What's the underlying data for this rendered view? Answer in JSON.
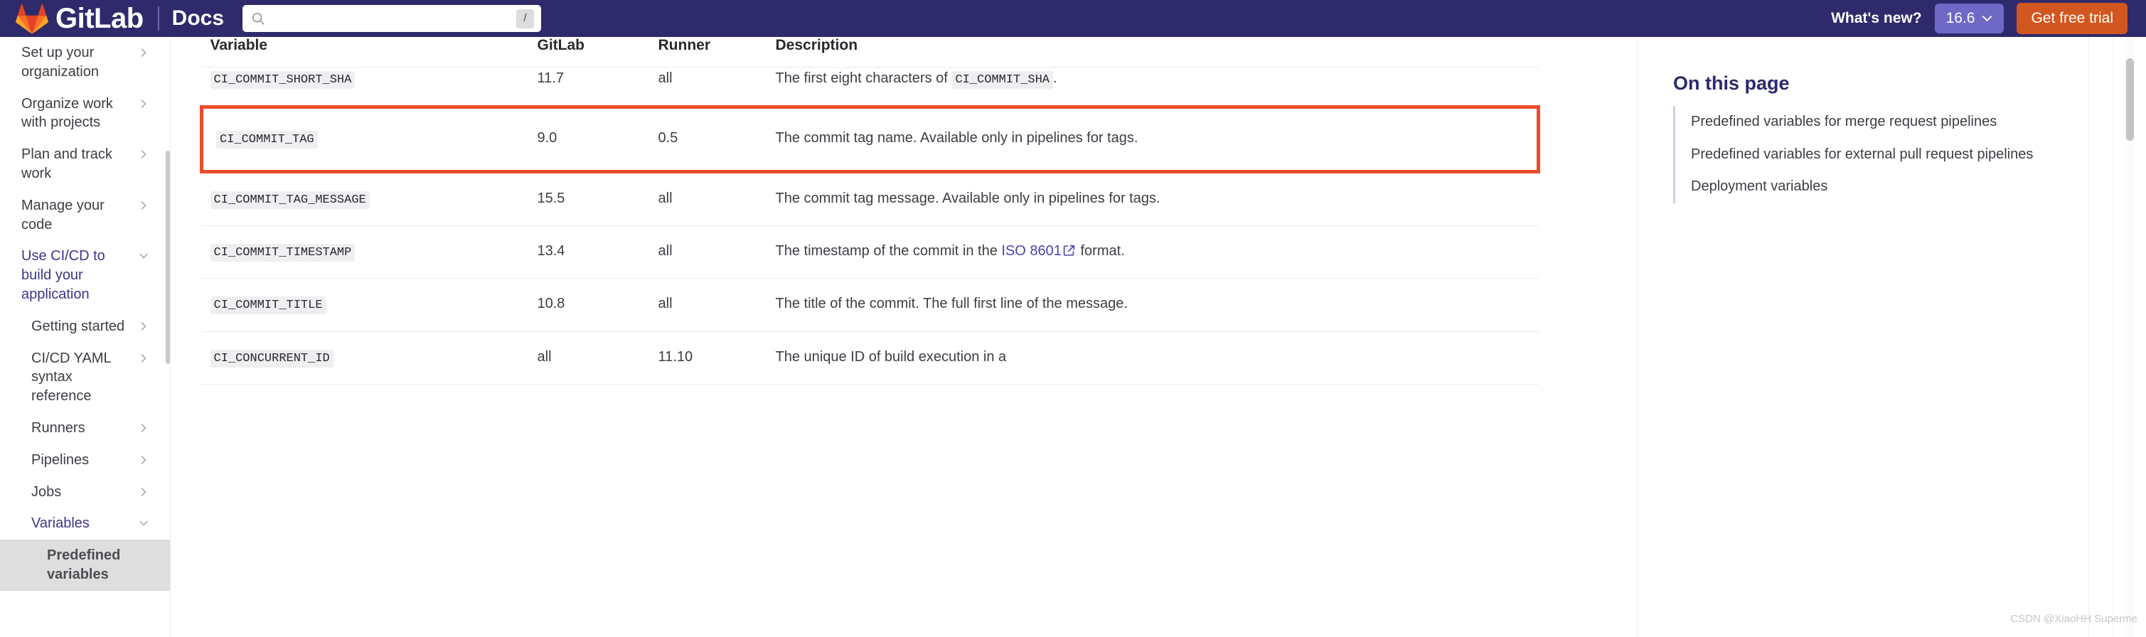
{
  "header": {
    "brand_name": "GitLab",
    "brand_suffix": "Docs",
    "search": {
      "value": "",
      "placeholder": "",
      "shortcut_key": "/",
      "icon": "search-icon"
    },
    "whats_new_label": "What's new?",
    "version_label": "16.6",
    "version_icon": "chevron-down-icon",
    "trial_label": "Get free trial",
    "colors": {
      "bar_bg": "#2f2a6b",
      "version_bg": "#6e69c4",
      "trial_bg": "#d2561f"
    }
  },
  "sidebar": {
    "items": [
      {
        "label": "Set up your organization",
        "icon": "chevron-right-icon",
        "level": 0,
        "state": "collapsed"
      },
      {
        "label": "Organize work with projects",
        "icon": "chevron-right-icon",
        "level": 0,
        "state": "collapsed"
      },
      {
        "label": "Plan and track work",
        "icon": "chevron-right-icon",
        "level": 0,
        "state": "collapsed"
      },
      {
        "label": "Manage your code",
        "icon": "chevron-right-icon",
        "level": 0,
        "state": "collapsed"
      },
      {
        "label": "Use CI/CD to build your application",
        "icon": "chevron-down-icon",
        "level": 0,
        "state": "expanded"
      },
      {
        "label": "Getting started",
        "icon": "chevron-right-icon",
        "level": 1,
        "state": "collapsed"
      },
      {
        "label": "CI/CD YAML syntax reference",
        "icon": "chevron-right-icon",
        "level": 1,
        "state": "collapsed"
      },
      {
        "label": "Runners",
        "icon": "chevron-right-icon",
        "level": 1,
        "state": "collapsed"
      },
      {
        "label": "Pipelines",
        "icon": "chevron-right-icon",
        "level": 1,
        "state": "collapsed"
      },
      {
        "label": "Jobs",
        "icon": "chevron-right-icon",
        "level": 1,
        "state": "collapsed"
      },
      {
        "label": "Variables",
        "icon": "chevron-down-icon",
        "level": 1,
        "state": "expanded"
      },
      {
        "label": "Predefined variables",
        "icon": "",
        "level": 2,
        "state": "current"
      }
    ]
  },
  "table": {
    "headers": [
      "Variable",
      "GitLab",
      "Runner",
      "Description"
    ],
    "rows": [
      {
        "variable": "CI_COMMIT_SHORT_SHA",
        "gitlab": "11.7",
        "runner": "all",
        "desc_prefix": "The first eight characters of ",
        "desc_code": "CI_COMMIT_SHA",
        "desc_suffix": ".",
        "clipped": true,
        "highlight": false
      },
      {
        "variable": "CI_COMMIT_TAG",
        "gitlab": "9.0",
        "runner": "0.5",
        "desc_prefix": "The commit tag name. Available only in pipelines for tags.",
        "desc_code": "",
        "desc_suffix": "",
        "clipped": false,
        "highlight": true
      },
      {
        "variable": "CI_COMMIT_TAG_MESSAGE",
        "gitlab": "15.5",
        "runner": "all",
        "desc_prefix": "The commit tag message. Available only in pipelines for tags.",
        "desc_code": "",
        "desc_suffix": "",
        "clipped": false,
        "highlight": false
      },
      {
        "variable": "CI_COMMIT_TIMESTAMP",
        "gitlab": "13.4",
        "runner": "all",
        "desc_prefix": "The timestamp of the commit in the ",
        "desc_link": "ISO 8601",
        "desc_link_icon": "external-link-icon",
        "desc_suffix": " format.",
        "clipped": false,
        "highlight": false
      },
      {
        "variable": "CI_COMMIT_TITLE",
        "gitlab": "10.8",
        "runner": "all",
        "desc_prefix": "The title of the commit. The full first line of the message.",
        "desc_code": "",
        "desc_suffix": "",
        "clipped": false,
        "highlight": false
      },
      {
        "variable": "CI_CONCURRENT_ID",
        "gitlab": "all",
        "runner": "11.10",
        "desc_prefix": "The unique ID of build execution in a",
        "desc_code": "",
        "desc_suffix": "",
        "clipped": false,
        "highlight": false
      }
    ],
    "highlight_color": "#ed4b2a"
  },
  "on_this_page": {
    "title": "On this page",
    "items": [
      "Predefined variables for merge request pipelines",
      "Predefined variables for external pull request pipelines",
      "Deployment variables"
    ]
  },
  "watermark": "CSDN @XiaoHH Superme"
}
